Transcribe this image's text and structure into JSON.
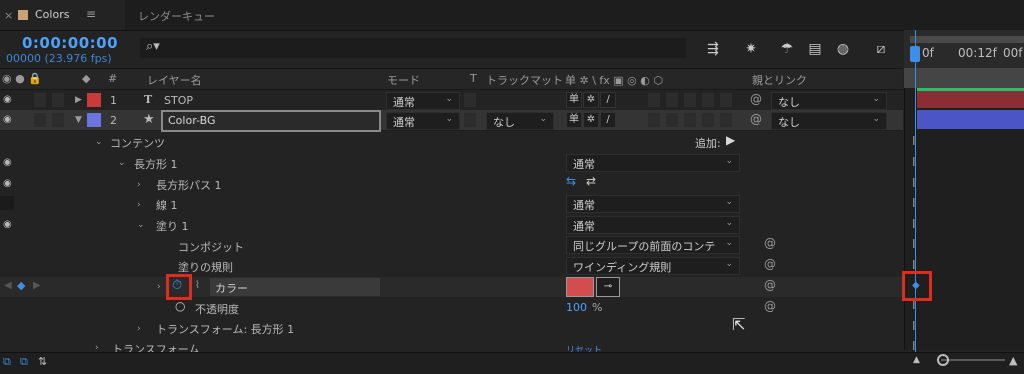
{
  "tabs": {
    "close": "×",
    "active_label": "Colors",
    "menu": "≡",
    "render_queue": "レンダーキュー"
  },
  "time": {
    "timecode": "0:00:00:00",
    "frames": "00000 (23.976 fps)"
  },
  "search": {
    "placeholder": ""
  },
  "columns": {
    "layer_name": "レイヤー名",
    "mode": "モード",
    "t": "T",
    "trackmatte": "トラックマット",
    "switches": "单 ✲ \\ fx ▣ ◎ ◐ ⬡",
    "parent": "親とリンク",
    "number": "#"
  },
  "layers": [
    {
      "num": "1",
      "type": "T",
      "name": "STOP",
      "color": "#c93a3a",
      "mode": "通常",
      "parent": "なし"
    },
    {
      "num": "2",
      "type": "★",
      "name": "Color-BG",
      "color": "#6b75e0",
      "mode": "通常",
      "trackmatte": "なし",
      "parent": "なし"
    }
  ],
  "tree": {
    "contents": "コンテンツ",
    "add": "追加:",
    "rect": "長方形 1",
    "rect_mode": "通常",
    "rect_path": "長方形パス 1",
    "stroke": "線 1",
    "stroke_mode": "通常",
    "fill": "塗り 1",
    "fill_mode": "通常",
    "composite": "コンポジット",
    "composite_value": "同じグループの前面のコンテ",
    "fill_rule": "塗りの規則",
    "fill_rule_value": "ワインディング規則",
    "color": "カラー",
    "color_value": "#d24c50",
    "opacity": "不透明度",
    "opacity_value": "100",
    "opacity_unit": "%",
    "transform_rect": "トランスフォーム: 長方形 1",
    "transform": "トランスフォーム",
    "reset": "リセット"
  },
  "timeline": {
    "tick0": "0f",
    "tick1": "00:12f",
    "tick2": "00f"
  },
  "colors": {
    "accent": "#3d8ee6",
    "highlight": "#e02b1f"
  }
}
